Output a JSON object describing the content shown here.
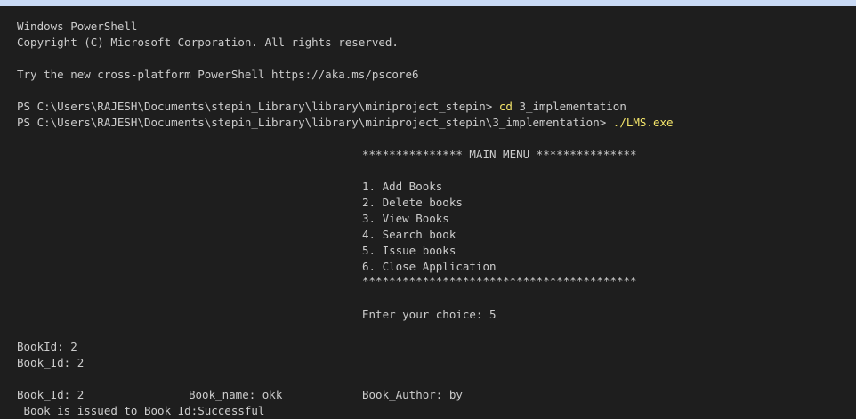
{
  "terminal": {
    "header1": "Windows PowerShell",
    "header2": "Copyright (C) Microsoft Corporation. All rights reserved.",
    "pscore": "Try the new cross-platform PowerShell https://aka.ms/pscore6",
    "prompt1": "PS C:\\Users\\RAJESH\\Documents\\stepin_Library\\library\\miniproject_stepin> ",
    "cmd1": "cd",
    "arg1": " 3_implementation",
    "prompt2": "PS C:\\Users\\RAJESH\\Documents\\stepin_Library\\library\\miniproject_stepin\\3_implementation> ",
    "cmd2": "./LMS.exe",
    "menu_title": "*************** MAIN MENU ***************",
    "menu_items": [
      "1. Add Books",
      "2. Delete books",
      "3. View Books",
      "4. Search book",
      "5. Issue books",
      "6. Close Application"
    ],
    "menu_border": "*****************************************",
    "choice_prompt": "Enter your choice: 5",
    "bookid_line": "BookId: 2",
    "book_id_line": "Book_Id: 2",
    "result_id": "Book_Id: 2",
    "result_name": "Book_name: okk",
    "result_author": "Book_Author: by",
    "issue_status": " Book is issued to Book Id:Successful"
  },
  "colors": {
    "background": "#1e1e1e",
    "text": "#cccccc",
    "command": "#f4e56a"
  }
}
